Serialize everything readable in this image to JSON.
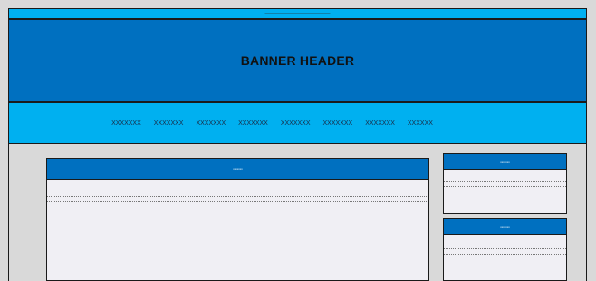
{
  "topbar": {
    "text": "xxxxxxxxxxxxxxxxxxxxxxxxxxxxxxxxxxxxxxxxxxxxxxxxxxxxxxxxxxxxxxxxxxxxxxxx"
  },
  "banner": {
    "title": "BANNER HEADER"
  },
  "nav": {
    "items": [
      "XXXXXXX",
      "XXXXXXX",
      "XXXXXXX",
      "XXXXXXX",
      "XXXXXXX",
      "XXXXXXX",
      "XXXXXXX",
      "XXXXXX"
    ]
  },
  "main_panel": {
    "title": "xxxxxxx",
    "text": "xxxxxxxxxxxxxxxxxxxxxxxxxxxxxxxxxxxxxxxxxxxxxxxxxxxxxxxxxxxxxxxxxxxxxxxxxxxxxxxxxxxx"
  },
  "side_panels": [
    {
      "title": "xxxxxxx",
      "text": "xxxxxxxxxxxxxxxxxxxxxxxxxxxxxxxxxxxxxxxxxxxxxxxxxx"
    },
    {
      "title": "xxxxxxx",
      "text": "xxxxxxxxxxxxxxxxxxxxxxxxxxxxxxxxxxxxxxxxxxxxxxxxxx"
    }
  ],
  "colors": {
    "primary": "#0070c0",
    "accent": "#00b0f0",
    "panel_bg": "#f0eff4",
    "page_bg": "#d9d9d9"
  }
}
